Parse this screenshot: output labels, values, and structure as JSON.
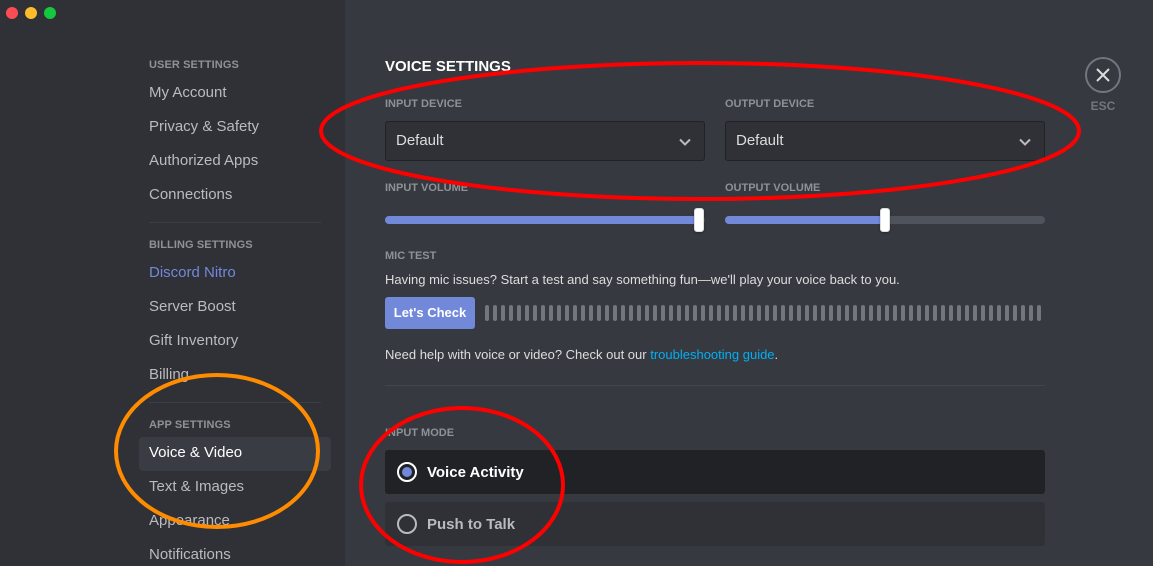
{
  "window": {
    "traffic_lights": [
      "close",
      "minimize",
      "maximize"
    ]
  },
  "sidebar": {
    "sections": [
      {
        "header": "User Settings",
        "items": [
          {
            "label": "My Account"
          },
          {
            "label": "Privacy & Safety"
          },
          {
            "label": "Authorized Apps"
          },
          {
            "label": "Connections"
          }
        ]
      },
      {
        "header": "Billing Settings",
        "items": [
          {
            "label": "Discord Nitro",
            "accent": true
          },
          {
            "label": "Server Boost"
          },
          {
            "label": "Gift Inventory"
          },
          {
            "label": "Billing"
          }
        ]
      },
      {
        "header": "App Settings",
        "items": [
          {
            "label": "Voice & Video",
            "active": true
          },
          {
            "label": "Text & Images"
          },
          {
            "label": "Appearance"
          },
          {
            "label": "Notifications"
          }
        ]
      }
    ]
  },
  "main": {
    "title": "Voice Settings",
    "input_device": {
      "label": "Input Device",
      "value": "Default"
    },
    "output_device": {
      "label": "Output Device",
      "value": "Default"
    },
    "input_volume": {
      "label": "Input Volume",
      "percent": 98
    },
    "output_volume": {
      "label": "Output Volume",
      "percent": 50
    },
    "mic_test": {
      "label": "Mic Test",
      "description": "Having mic issues? Start a test and say something fun—we'll play your voice back to you.",
      "button": "Let's Check",
      "meter_bars": 70
    },
    "help": {
      "prefix": "Need help with voice or video? Check out our ",
      "link": "troubleshooting guide",
      "suffix": "."
    },
    "input_mode": {
      "label": "Input Mode",
      "options": [
        {
          "label": "Voice Activity",
          "selected": true
        },
        {
          "label": "Push to Talk",
          "selected": false
        }
      ]
    }
  },
  "close": {
    "label": "ESC",
    "icon": "close-icon"
  },
  "annotations": [
    {
      "shape": "ellipse",
      "color": "#ff0000",
      "target": "input/output device selectors"
    },
    {
      "shape": "ellipse",
      "color": "#ff8c00",
      "target": "Voice & Video sidebar item"
    },
    {
      "shape": "ellipse",
      "color": "#ff0000",
      "target": "input mode radio buttons"
    }
  ],
  "colors": {
    "accent": "#7289da",
    "link": "#00b0f4",
    "sidebar_bg": "#2f3136",
    "main_bg": "#36393f"
  }
}
